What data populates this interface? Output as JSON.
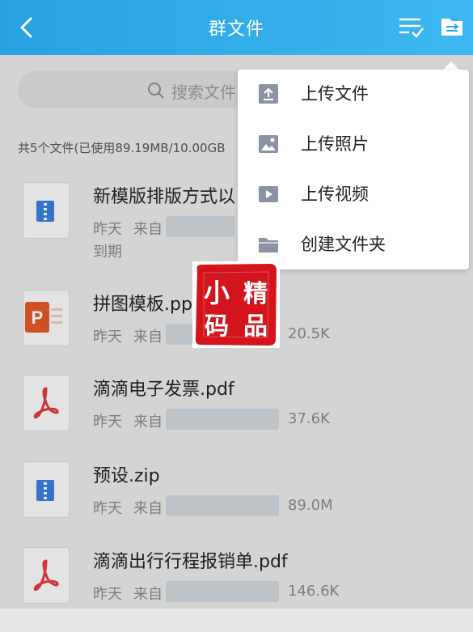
{
  "header": {
    "title": "群文件",
    "back": "back",
    "multiselect": "multi-select",
    "transfer": "transfer"
  },
  "search": {
    "placeholder": "搜索文件"
  },
  "summary": "共5个文件(已使用89.19MB/10.00GB",
  "menu": {
    "items": [
      {
        "label": "上传文件",
        "icon": "upload-file-icon"
      },
      {
        "label": "上传照片",
        "icon": "upload-photo-icon"
      },
      {
        "label": "上传视频",
        "icon": "upload-video-icon"
      },
      {
        "label": "创建文件夹",
        "icon": "create-folder-icon"
      }
    ]
  },
  "files": [
    {
      "name": "新模版排版方式以",
      "time": "昨天",
      "source": "来自",
      "size": "",
      "extra": "到期",
      "type": "zip"
    },
    {
      "name": "拼图模板.pp",
      "time": "昨天",
      "source": "来自",
      "size": "20.5K",
      "extra": "",
      "type": "ppt"
    },
    {
      "name": "滴滴电子发票.pdf",
      "time": "昨天",
      "source": "来自",
      "size": "37.6K",
      "extra": "",
      "type": "pdf"
    },
    {
      "name": "预设.zip",
      "time": "昨天",
      "source": "来自",
      "size": "89.0M",
      "extra": "",
      "type": "zip"
    },
    {
      "name": "滴滴出行行程报销单.pdf",
      "time": "昨天",
      "source": "来自",
      "size": "146.6K",
      "extra": "",
      "type": "pdf"
    }
  ],
  "watermark": {
    "text": "小精码品"
  },
  "colors": {
    "header": "#2aa8e8",
    "menu_icon": "#8a93a1",
    "pdf_red": "#e0393e",
    "ppt_orange": "#e2572a",
    "zip_blue": "#3b7ddd"
  }
}
